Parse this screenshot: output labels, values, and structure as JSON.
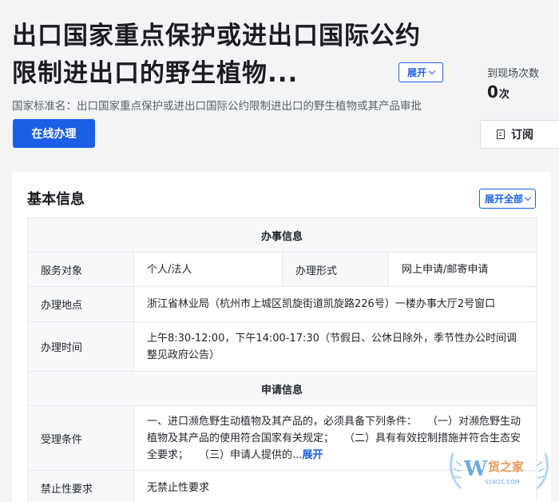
{
  "header": {
    "title": "出口国家重点保护或进出口国际公约限制进出口的野生植物...",
    "expand_label": "展开",
    "standard_name": "国家标准名：出口国家重点保护或进出口国际公约限制进出口的野生植物或其产品审批",
    "online_button": "在线办理",
    "visits_label": "到现场次数",
    "visits_value": "0",
    "visits_unit": "次",
    "subscribe_label": "订阅"
  },
  "basic_info": {
    "title": "基本信息",
    "expand_all_label": "展开全部",
    "section1_title": "办事信息",
    "service_target_label": "服务对象",
    "service_target_value": "个人/法人",
    "handling_form_label": "办理形式",
    "handling_form_value": "网上申请/邮寄申请",
    "location_label": "办理地点",
    "location_value": "浙江省林业局（杭州市上城区凯旋街道凯旋路226号）一楼办事大厅2号窗口",
    "time_label": "办理时间",
    "time_value": "上午8:30-12:00，下午14:00-17:30（节假日、公休日除外，季节性办公时间调整见政府公告）",
    "section2_title": "申请信息",
    "acceptance_label": "受理条件",
    "acceptance_value": "一、进口濒危野生动植物及其产品的，必须具备下列条件：　　（一）对濒危野生动植物及其产品的使用符合国家有关规定；　　（二）具有有效控制措施并符合生态安全要求；　　（三）申请人提供的...",
    "acceptance_more": "展开",
    "prohibited_label": "禁止性要求",
    "prohibited_value": "无禁止性要求"
  },
  "watermark": {
    "brand": "货之家",
    "domain": "S1W2C.COM"
  },
  "colors": {
    "accent": "#1a5fe6",
    "background": "#f3f4f6",
    "table_header_bg": "#f7f8fa"
  }
}
